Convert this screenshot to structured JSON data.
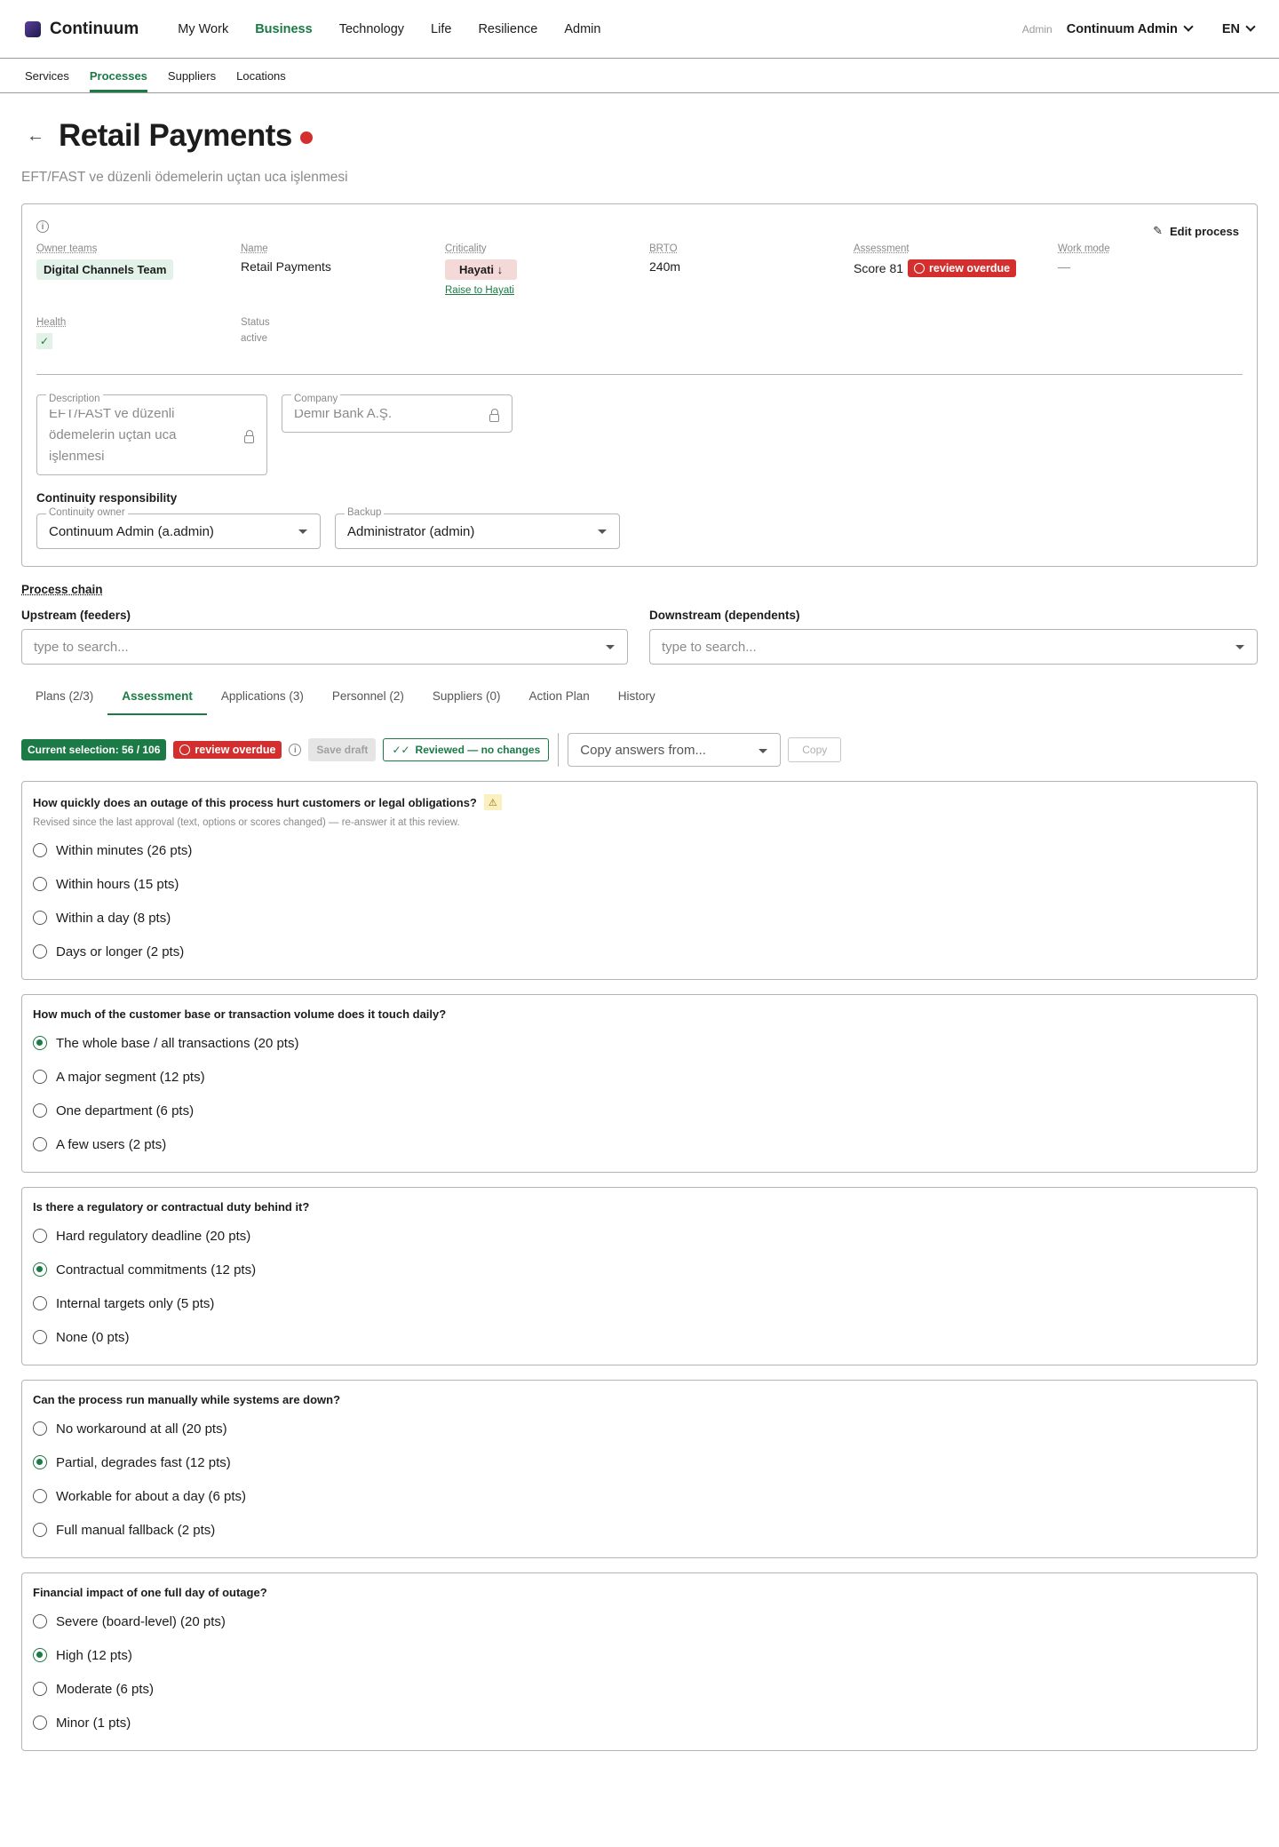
{
  "app": {
    "name": "Continuum"
  },
  "nav": [
    "My Work",
    "Business",
    "Technology",
    "Life",
    "Resilience",
    "Admin"
  ],
  "nav_active": 1,
  "user": {
    "role": "Admin",
    "name": "Continuum Admin",
    "lang": "EN"
  },
  "subnav": [
    "Services",
    "Processes",
    "Suppliers",
    "Locations"
  ],
  "subnav_active": 1,
  "page": {
    "title": "Retail Payments",
    "subtitle": "EFT/FAST ve düzenli ödemelerin uçtan uca işlenmesi",
    "edit": "Edit process"
  },
  "fields": {
    "owner_label": "Owner teams",
    "owner": "Digital Channels Team",
    "name_label": "Name",
    "name": "Retail Payments",
    "crit_label": "Criticality",
    "crit": "Hayati ↓",
    "crit_raise": "Raise to Hayati",
    "brto_label": "BRTO",
    "brto": "240m",
    "assess_label": "Assessment",
    "assess": "Score 81",
    "assess_badge": "review overdue",
    "work_label": "Work mode",
    "work": "—",
    "health_label": "Health",
    "health": "✓",
    "status_label": "Status",
    "status": "active"
  },
  "description": {
    "label": "Description",
    "value": "EFT/FAST ve düzenli ödemelerin uçtan uca işlenmesi"
  },
  "company": {
    "label": "Company",
    "value": "Demir Bank A.Ş."
  },
  "responsibility": {
    "title": "Continuity responsibility",
    "owner_label": "Continuity owner",
    "owner": "Continuum Admin (a.admin)",
    "backup_label": "Backup",
    "backup": "Administrator (admin)"
  },
  "chain": {
    "title": "Process chain",
    "up": "Upstream (feeders)",
    "down": "Downstream (dependents)",
    "placeholder": "type to search..."
  },
  "tabs": [
    "Plans (2/3)",
    "Assessment",
    "Applications (3)",
    "Personnel (2)",
    "Suppliers (0)",
    "Action Plan",
    "History"
  ],
  "tabs_active": 1,
  "toolbar": {
    "selection": "Current selection: 56 / 106",
    "overdue": "review overdue",
    "save": "Save draft",
    "reviewed": "Reviewed — no changes",
    "copy_from": "Copy answers from...",
    "copy": "Copy"
  },
  "questions": [
    {
      "text": "How quickly does an outage of this process hurt customers or legal obligations?",
      "warn": true,
      "note": "Revised since the last approval (text, options or scores changed) — re-answer it at this review.",
      "options": [
        "Within minutes (26 pts)",
        "Within hours (15 pts)",
        "Within a day (8 pts)",
        "Days or longer (2 pts)"
      ],
      "selected": -1
    },
    {
      "text": "How much of the customer base or transaction volume does it touch daily?",
      "warn": false,
      "note": "",
      "options": [
        "The whole base / all transactions (20 pts)",
        "A major segment (12 pts)",
        "One department (6 pts)",
        "A few users (2 pts)"
      ],
      "selected": 0
    },
    {
      "text": "Is there a regulatory or contractual duty behind it?",
      "warn": false,
      "note": "",
      "options": [
        "Hard regulatory deadline (20 pts)",
        "Contractual commitments (12 pts)",
        "Internal targets only (5 pts)",
        "None (0 pts)"
      ],
      "selected": 1
    },
    {
      "text": "Can the process run manually while systems are down?",
      "warn": false,
      "note": "",
      "options": [
        "No workaround at all (20 pts)",
        "Partial, degrades fast (12 pts)",
        "Workable for about a day (6 pts)",
        "Full manual fallback (2 pts)"
      ],
      "selected": 1
    },
    {
      "text": "Financial impact of one full day of outage?",
      "warn": false,
      "note": "",
      "options": [
        "Severe (board-level) (20 pts)",
        "High (12 pts)",
        "Moderate (6 pts)",
        "Minor (1 pts)"
      ],
      "selected": 1
    }
  ],
  "colors": {
    "accent": "#1b7a45",
    "danger": "#d32f2f"
  }
}
